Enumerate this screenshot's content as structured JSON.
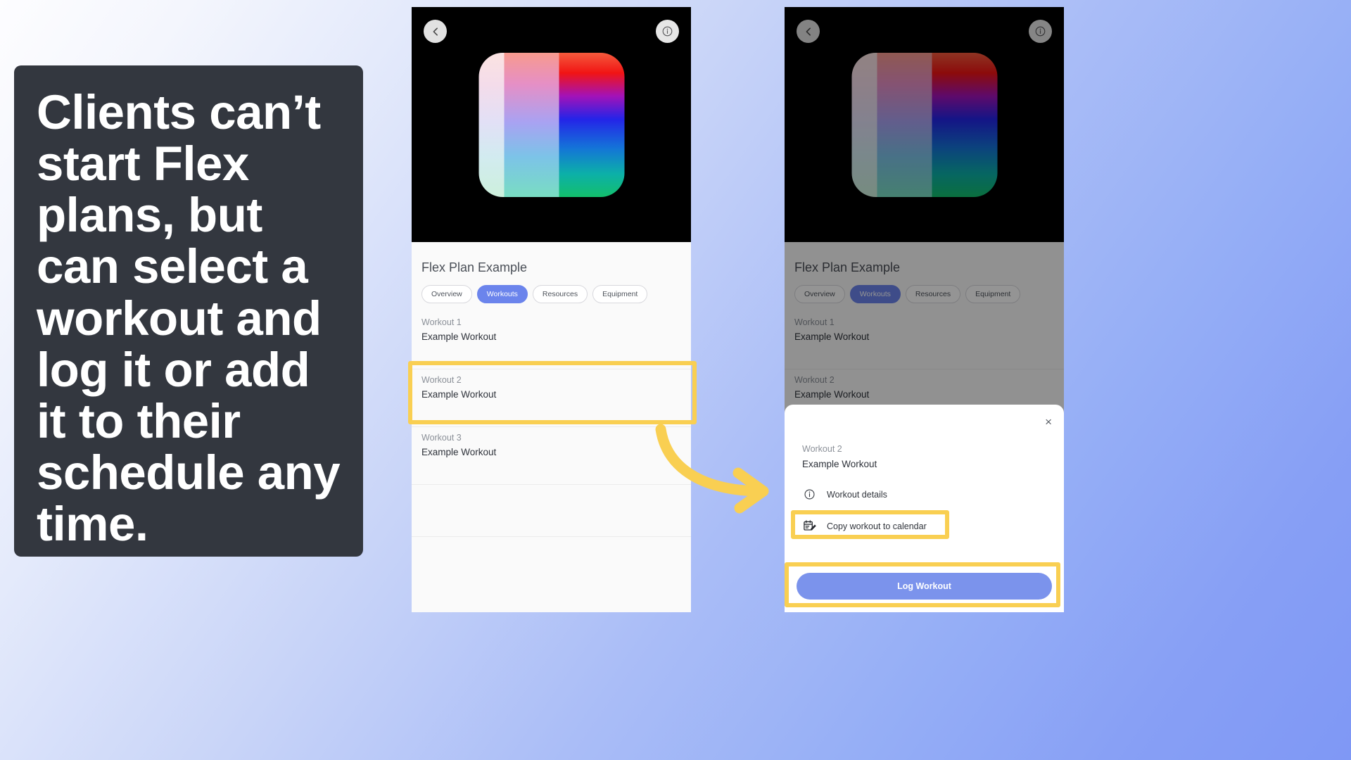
{
  "quote": {
    "text": "Clients can’t start Flex plans, but can select a workout and log it or add it to their schedule any time."
  },
  "colors": {
    "accent_blue": "#6b84ec",
    "highlight_yellow": "#f9cf52",
    "card_dark": "#33373f",
    "hero_black": "#000000",
    "background_start": "#fdfdff",
    "background_end": "#7f98f5"
  },
  "phone_a": {
    "header": {
      "back_icon": "chevron-left-icon",
      "info_icon": "info-circle-icon",
      "logo_icon": "flex-chevron-logo"
    },
    "plan_title": "Flex Plan Example",
    "tabs": [
      {
        "label": "Overview",
        "active": false
      },
      {
        "label": "Workouts",
        "active": true
      },
      {
        "label": "Resources",
        "active": false
      },
      {
        "label": "Equipment",
        "active": false
      }
    ],
    "workouts": [
      {
        "number": "Workout 1",
        "name": "Example Workout",
        "highlighted": false
      },
      {
        "number": "Workout 2",
        "name": "Example Workout",
        "highlighted": true
      },
      {
        "number": "Workout 3",
        "name": "Example Workout",
        "highlighted": false
      }
    ]
  },
  "phone_b": {
    "header": {
      "back_icon": "chevron-left-icon",
      "info_icon": "info-circle-icon",
      "logo_icon": "flex-chevron-logo"
    },
    "plan_title": "Flex Plan Example",
    "tabs": [
      {
        "label": "Overview",
        "active": false
      },
      {
        "label": "Workouts",
        "active": true
      },
      {
        "label": "Resources",
        "active": false
      },
      {
        "label": "Equipment",
        "active": false
      }
    ],
    "workouts": [
      {
        "number": "Workout 1",
        "name": "Example Workout"
      },
      {
        "number": "Workout 2",
        "name": "Example Workout"
      }
    ],
    "sheet": {
      "close_label": "×",
      "workout_number": "Workout 2",
      "workout_name": "Example Workout",
      "actions": [
        {
          "label": "Workout details",
          "icon": "info-circle-icon",
          "highlighted": false
        },
        {
          "label": "Copy workout to calendar",
          "icon": "calendar-edit-icon",
          "highlighted": true
        }
      ],
      "primary_button": "Log Workout"
    }
  },
  "annotation": {
    "arrow_icon": "curved-arrow-icon"
  }
}
